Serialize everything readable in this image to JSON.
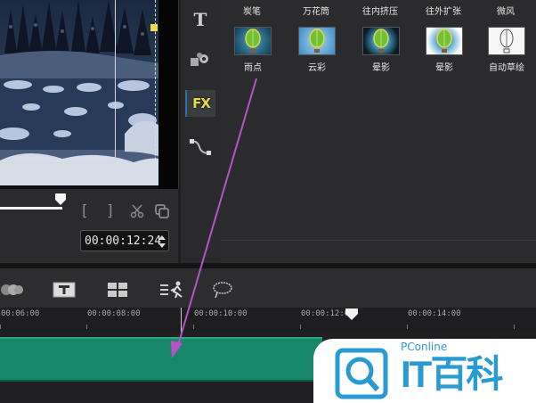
{
  "preview": {
    "timecode": "00:00:12:24"
  },
  "sidebar": {
    "title_tool": "T",
    "fx_tool": "FX"
  },
  "library": {
    "top_row": [
      {
        "label": "炭笔"
      },
      {
        "label": "万花筒"
      },
      {
        "label": "往内挤压"
      },
      {
        "label": "往外扩张"
      },
      {
        "label": "微风"
      }
    ],
    "tiles": [
      {
        "label": "雨点",
        "thumb": "balloon-dark"
      },
      {
        "label": "云彩",
        "thumb": "balloon-sky"
      },
      {
        "label": "晕影",
        "thumb": "balloon-dark-vignette"
      },
      {
        "label": "晕影",
        "thumb": "balloon-white-vignette"
      },
      {
        "label": "自动草绘",
        "thumb": "balloon-sketch"
      }
    ]
  },
  "timeline": {
    "ruler_labels": [
      "00:06:00",
      "00:00:08:00",
      "00:00:10:00",
      "00:00:12:00",
      "00:00:14:00"
    ]
  },
  "watermark": {
    "brand_top": "PConline",
    "brand_main": "IT百科"
  },
  "colors": {
    "track": "#17876a",
    "fx_label": "#e8d84a",
    "arrow": "#b552c8",
    "watermark_blue": "#2a9ad2"
  }
}
